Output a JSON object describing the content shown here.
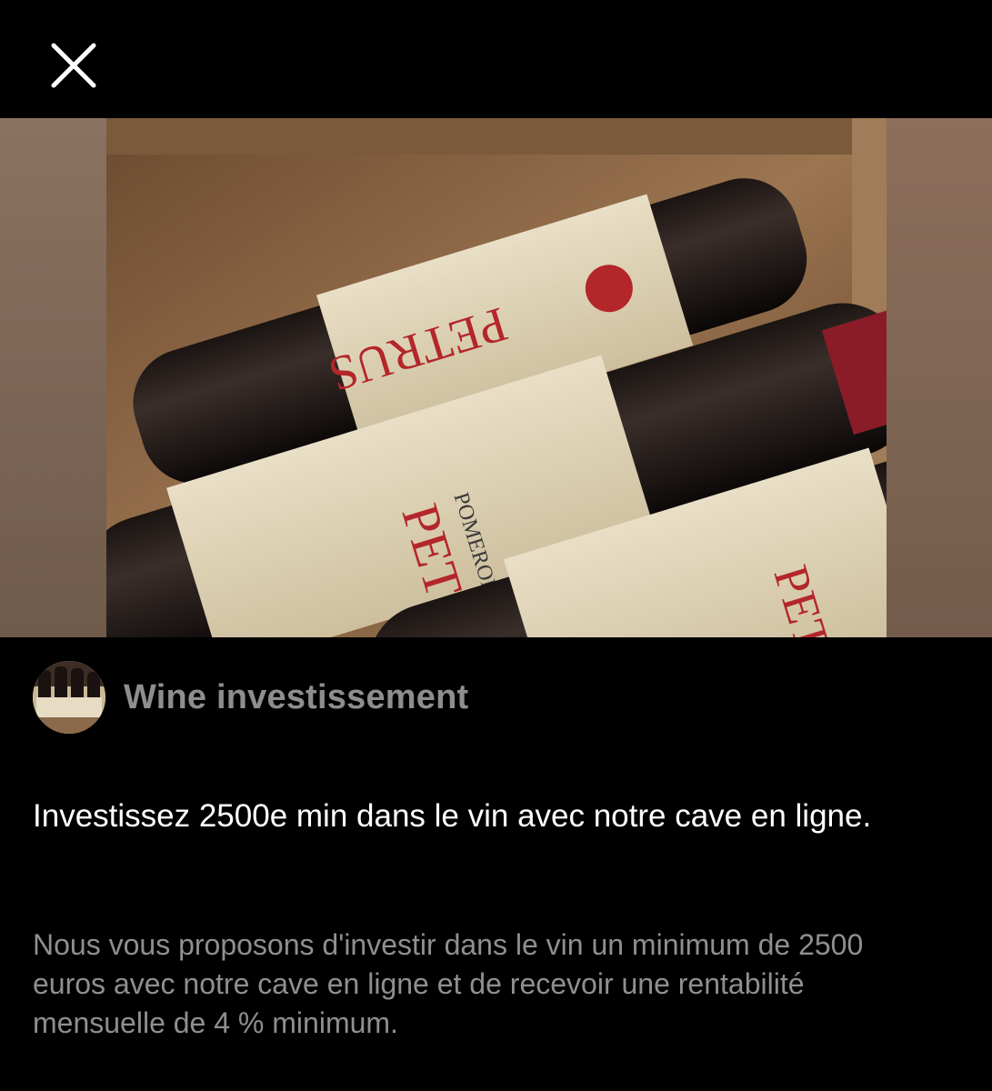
{
  "topbar": {
    "close_icon": "close-icon"
  },
  "media": {
    "image": "wine-bottles-photo",
    "colors": {
      "side_left": "#7a6452",
      "side_right": "#8c6f5b"
    }
  },
  "author": {
    "name": "Wine investissement",
    "avatar": "wine-bottles-avatar"
  },
  "post": {
    "headline": "Investissez 2500e min dans le vin avec notre cave en ligne.",
    "description": "Nous vous proposons d'investir dans le vin un minimum de 2500 euros avec notre cave en ligne et de recevoir une rentabilité mensuelle de 4 % minimum."
  },
  "colors": {
    "background": "#000000",
    "author_name": "#8e8e8e",
    "headline": "#ffffff",
    "description": "#8f8f8f"
  }
}
